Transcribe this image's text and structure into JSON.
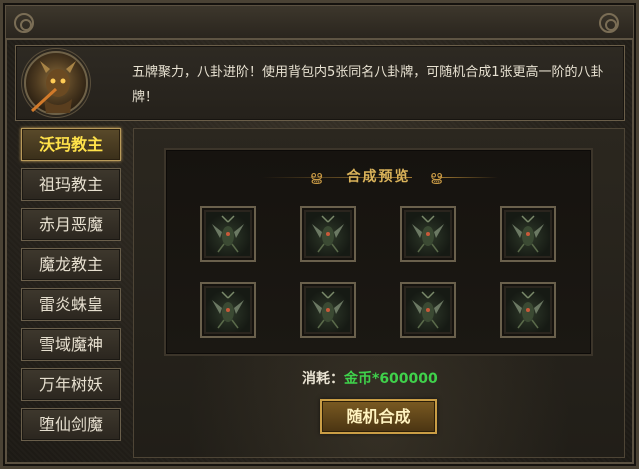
{
  "header": {
    "description": "五牌聚力，八卦进阶！使用背包内5张同名八卦牌，可随机合成1张更高一阶的八卦牌！",
    "portrait_icon": "demon-boss-portrait-icon"
  },
  "sidebar": {
    "items": [
      {
        "label": "沃玛教主",
        "active": true
      },
      {
        "label": "祖玛教主",
        "active": false
      },
      {
        "label": "赤月恶魔",
        "active": false
      },
      {
        "label": "魔龙教主",
        "active": false
      },
      {
        "label": "雷炎蛛皇",
        "active": false
      },
      {
        "label": "雪域魔神",
        "active": false
      },
      {
        "label": "万年树妖",
        "active": false
      },
      {
        "label": "堕仙剑魔",
        "active": false
      }
    ]
  },
  "preview": {
    "title": "合成预览",
    "slot_icon": "winged-insect-card-icon",
    "slot_count": 8
  },
  "cost": {
    "label": "消耗：",
    "value": "金币*600000"
  },
  "actions": {
    "synthesize_label": "随机合成"
  },
  "colors": {
    "active_text": "#ffe24a",
    "cost_value": "#3fd24b",
    "title_gold": "#d9b25a"
  }
}
